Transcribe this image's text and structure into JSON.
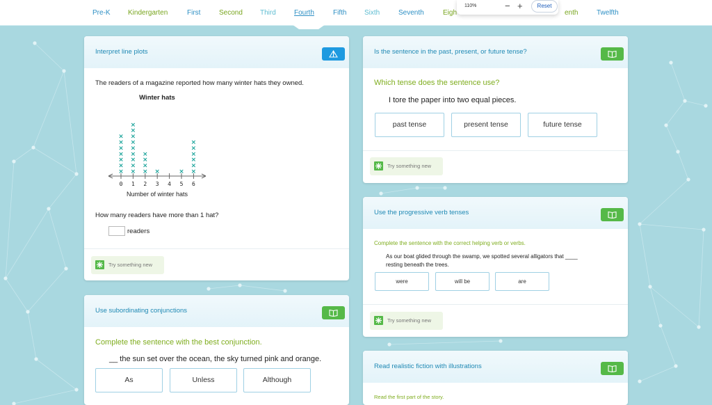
{
  "nav": {
    "grades": [
      {
        "label": "Pre-K",
        "color": "#2d8fc4"
      },
      {
        "label": "Kindergarten",
        "color": "#78a51e"
      },
      {
        "label": "First",
        "color": "#2d8fc4"
      },
      {
        "label": "Second",
        "color": "#78a51e"
      },
      {
        "label": "Third",
        "color": "#5dbcd1"
      },
      {
        "label": "Fourth",
        "color": "#2d8fc4"
      },
      {
        "label": "Fifth",
        "color": "#2d8fc4"
      },
      {
        "label": "Sixth",
        "color": "#5dbcd1"
      },
      {
        "label": "Seventh",
        "color": "#2d8fc4"
      },
      {
        "label": "Eigh",
        "color": "#78a51e"
      },
      {
        "label": "enth",
        "color": "#78a51e"
      },
      {
        "label": "Twelfth",
        "color": "#2d8fc4"
      }
    ],
    "active_grade": "Fourth"
  },
  "zoom": {
    "level": "110%",
    "minus": "−",
    "plus": "+",
    "reset": "Reset"
  },
  "cards": {
    "line_plot": {
      "title": "Interpret line plots",
      "icon": "pyramid-icon",
      "intro": "The readers of a magazine reported how many winter hats they owned.",
      "question": "How many readers have more than 1 hat?",
      "answer_value": "",
      "answer_unit": "readers",
      "try_label": "Try something new"
    },
    "tense": {
      "title": "Is the sentence in the past, present, or future tense?",
      "icon": "book-icon",
      "prompt": "Which tense does the sentence use?",
      "sentence": "I tore the paper into two equal pieces.",
      "choices": [
        "past tense",
        "present tense",
        "future tense"
      ],
      "try_label": "Try something new"
    },
    "progressive": {
      "title": "Use the progressive verb tenses",
      "icon": "book-icon",
      "prompt": "Complete the sentence with the correct helping verb or verbs.",
      "sentence_line1": "As our boat glided through the swamp, we spotted several alligators that ____",
      "sentence_line2": "resting beneath the trees.",
      "choices": [
        "were",
        "will be",
        "are"
      ],
      "try_label": "Try something new"
    },
    "conjunctions": {
      "title": "Use subordinating conjunctions",
      "icon": "book-icon",
      "prompt": "Complete the sentence with the best conjunction.",
      "sentence": "__ the sun set over the ocean, the sky turned pink and orange.",
      "choices": [
        "As",
        "Unless",
        "Although"
      ]
    },
    "fiction": {
      "title": "Read realistic fiction with illustrations",
      "icon": "book-icon",
      "prompt": "Read the first part of the story."
    }
  },
  "chart_data": {
    "type": "line_plot",
    "title": "Winter hats",
    "xlabel": "Number of winter hats",
    "categories": [
      "0",
      "1",
      "2",
      "3",
      "4",
      "5",
      "6"
    ],
    "values": [
      7,
      9,
      4,
      1,
      0,
      1,
      6
    ],
    "marker": "×",
    "marker_color": "#1aa39a"
  }
}
